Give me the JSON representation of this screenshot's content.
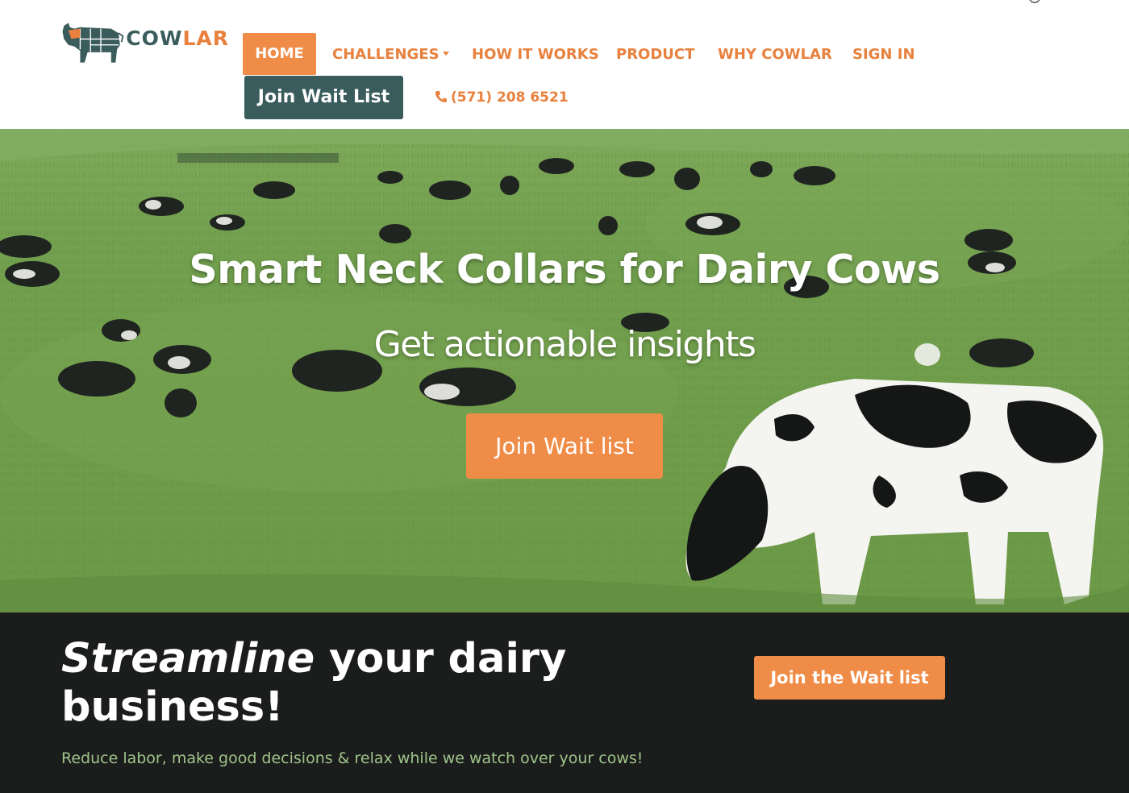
{
  "brand": {
    "name_part1": "COW",
    "name_part2": "LAR",
    "primary_color": "#3b5c5c",
    "accent_color": "#ef8c47"
  },
  "nav": {
    "home": "HOME",
    "challenges": "CHALLENGES",
    "how_it_works": "HOW IT WORKS",
    "product": "PRODUCT",
    "why_cowlar": "WHY COWLAR",
    "sign_in": "SIGN IN",
    "join_wait_list": "Join Wait List",
    "phone": "(571) 208 6521",
    "phone_icon": "phone-icon",
    "challenges_icon": "caret-down-icon"
  },
  "hero": {
    "title": "Smart Neck Collars for Dairy Cows",
    "subtitle": "Get actionable insights",
    "cta": "Join Wait list",
    "background": "grazing-cows-pasture"
  },
  "band": {
    "heading_em": "Streamline",
    "heading_rest": " your dairy business!",
    "text": "Reduce labor, make good decisions & relax while we watch over your cows!",
    "cta": "Join the Wait list"
  }
}
